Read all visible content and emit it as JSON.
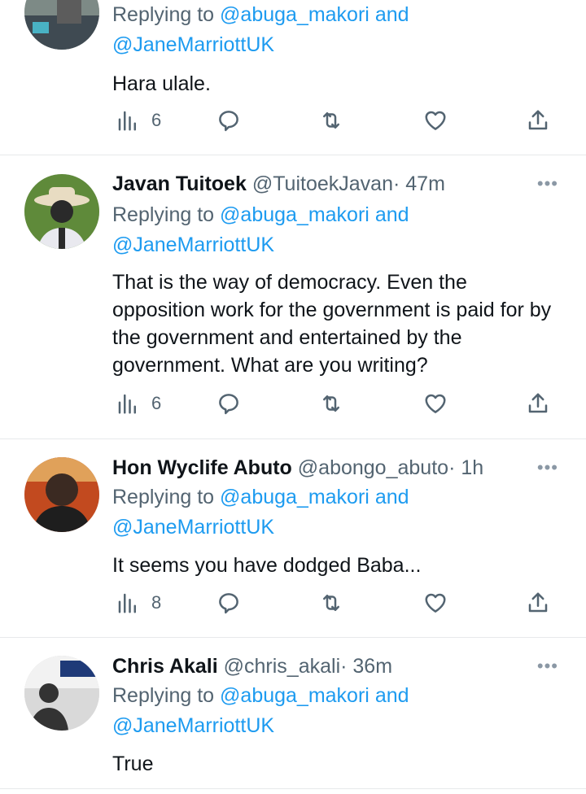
{
  "tweets": [
    {
      "name": "",
      "handle": "",
      "time": "",
      "reply_prefix": "Replying to",
      "reply_user1": "@abuga_makori",
      "reply_and": "and",
      "reply_user2": "@JaneMarriottUK",
      "text": "Hara ulale.",
      "views": "6",
      "avatar_colors": [
        "#7d8a86",
        "#3f4a52",
        "#49b2c4"
      ]
    },
    {
      "name": "Javan Tuitoek",
      "handle": "@TuitoekJavan",
      "dot": "·",
      "time": "47m",
      "reply_prefix": "Replying to",
      "reply_user1": "@abuga_makori",
      "reply_and": "and",
      "reply_user2": "@JaneMarriottUK",
      "text": "That is the way of democracy. Even the opposition work for the government is paid for by the government and entertained by the government. What are you writing?",
      "views": "6",
      "avatar_colors": [
        "#5f8a3a",
        "#e8dcc2",
        "#2a2a2a"
      ]
    },
    {
      "name": "Hon Wyclife Abuto",
      "handle": "@abongo_abuto",
      "dot": "·",
      "time": "1h",
      "reply_prefix": "Replying to",
      "reply_user1": "@abuga_makori",
      "reply_and": "and",
      "reply_user2": "@JaneMarriottUK",
      "text": "It seems you have dodged Baba...",
      "views": "8",
      "avatar_colors": [
        "#c24a1f",
        "#3b2a22",
        "#1e1e1e"
      ]
    },
    {
      "name": "Chris Akali",
      "handle": "@chris_akali",
      "dot": "·",
      "time": "36m",
      "reply_prefix": "Replying to",
      "reply_user1": "@abuga_makori",
      "reply_and": "and",
      "reply_user2": "@JaneMarriottUK",
      "text": "True",
      "avatar_colors": [
        "#f2f2f2",
        "#1f3a78",
        "#333333"
      ]
    }
  ],
  "more_glyph": "•••",
  "colors": {
    "link": "#1d9bf0",
    "secondary": "#536471",
    "divider": "#e7e9eb"
  }
}
